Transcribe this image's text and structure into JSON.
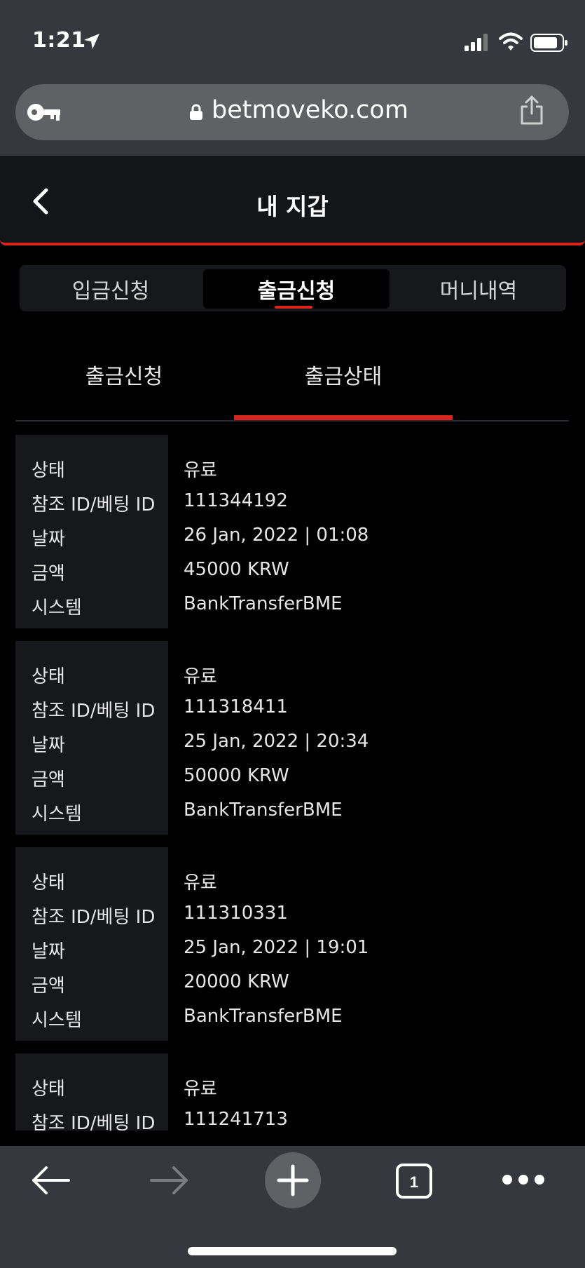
{
  "status_bar": {
    "time": "1:21"
  },
  "browser": {
    "url": "betmoveko.com"
  },
  "header": {
    "title": "내 지갑"
  },
  "top_tabs": [
    {
      "label": "입금신청"
    },
    {
      "label": "출금신청"
    },
    {
      "label": "머니내역"
    }
  ],
  "sub_tabs": [
    {
      "label": "출금신청"
    },
    {
      "label": "출금상태"
    }
  ],
  "labels": {
    "status": "상태",
    "ref_id": "참조 ID/베팅 ID",
    "date": "날짜",
    "amount": "금액",
    "system": "시스템"
  },
  "records": [
    {
      "status": "유료",
      "ref_id": "111344192",
      "date": "26 Jan, 2022 | 01:08",
      "amount": "45000 KRW",
      "system": "BankTransferBME"
    },
    {
      "status": "유료",
      "ref_id": "111318411",
      "date": "25 Jan, 2022 | 20:34",
      "amount": "50000 KRW",
      "system": "BankTransferBME"
    },
    {
      "status": "유료",
      "ref_id": "111310331",
      "date": "25 Jan, 2022 | 19:01",
      "amount": "20000 KRW",
      "system": "BankTransferBME"
    },
    {
      "status": "유료",
      "ref_id": "111241713"
    }
  ],
  "toolbar": {
    "tab_count": "1"
  },
  "colors": {
    "accent": "#d9241b",
    "chrome": "#37383d",
    "panel": "#17181c"
  }
}
